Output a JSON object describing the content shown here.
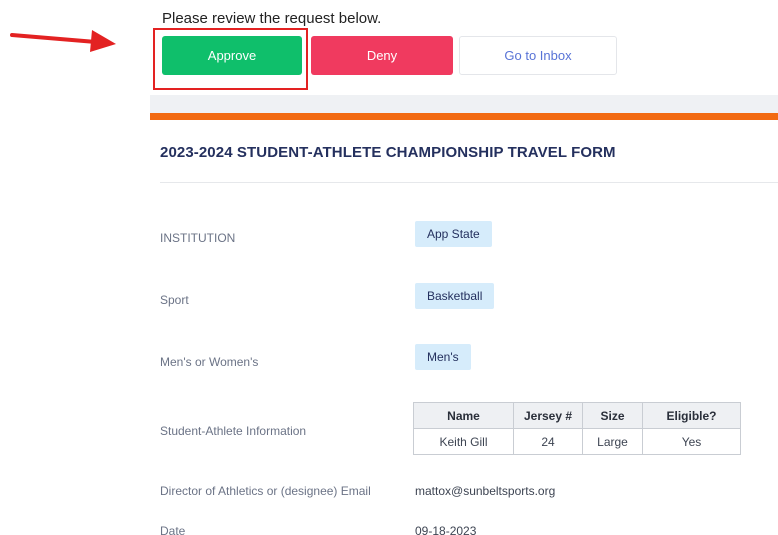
{
  "header": {
    "review_text": "Please review the request below."
  },
  "actions": {
    "approve_label": "Approve",
    "deny_label": "Deny",
    "inbox_label": "Go to Inbox"
  },
  "form": {
    "title": "2023-2024 STUDENT-ATHLETE CHAMPIONSHIP TRAVEL FORM",
    "fields": {
      "institution": {
        "label": "INSTITUTION",
        "value": "App State"
      },
      "sport": {
        "label": "Sport",
        "value": "Basketball"
      },
      "gender": {
        "label": "Men's or Women's",
        "value": "Men's"
      },
      "athlete_info": {
        "label": "Student-Athlete Information"
      },
      "director_email": {
        "label": "Director of Athletics or (designee) Email",
        "value": "mattox@sunbeltsports.org"
      },
      "date": {
        "label": "Date",
        "value": "09-18-2023"
      }
    },
    "athletes_table": {
      "headers": [
        "Name",
        "Jersey #",
        "Size",
        "Eligible?"
      ],
      "rows": [
        [
          "Keith Gill",
          "24",
          "Large",
          "Yes"
        ]
      ]
    }
  },
  "colors": {
    "approve": "#0fbf6b",
    "deny": "#f03a5f",
    "accent_bar": "#f26a12",
    "highlight": "#e32222",
    "pill_bg": "#d6ecfb"
  }
}
